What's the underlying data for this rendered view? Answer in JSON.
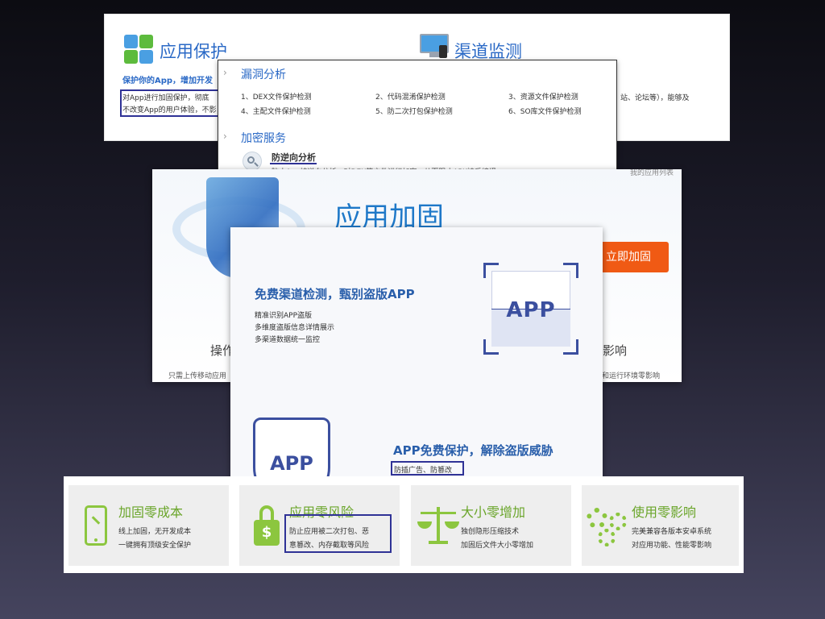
{
  "slide1": {
    "left_title": "应用保护",
    "left_subtitle": "保护你的App，增加开发",
    "left_desc_1": "对App进行加固保护，彻底",
    "left_desc_2": "不改变App的用户体验，不影",
    "right_title": "渠道监测",
    "right_partial": "站、论坛等），能够及"
  },
  "dropdown": {
    "section1_title": "漏洞分析",
    "items": [
      "1、DEX文件保护检测",
      "2、代码混淆保护检测",
      "3、资源文件保护检测",
      "4、主配文件保护检测",
      "5、防二次打包保护检测",
      "6、SO库文件保护检测"
    ],
    "section2_title": "加密服务",
    "service_name": "防逆向分析",
    "service_desc": "防止App被逆向分析，对DEX等文件进行加密，从而阻止APK被反编译"
  },
  "slide2": {
    "title": "应用加固",
    "button": "立即加固",
    "top_right_link": "我的应用列表",
    "left_feature": "操作",
    "left_footer": "只需上传移动应用",
    "right_feature": "影响",
    "right_footer": "能和运行环境零影响"
  },
  "slide3": {
    "block1_title": "免费渠道检测，甄别盗版APP",
    "block1_lines": [
      "精准识别APP盗版",
      "多维度盗版信息详情展示",
      "多渠道数据统一监控"
    ],
    "app_label": "APP",
    "block2_title": "APP免费保护，解除盗版威胁",
    "block2_line": "防插广告、防篡改"
  },
  "features": [
    {
      "title": "加固零成本",
      "line1": "线上加固，无开发成本",
      "line2": "一键拥有顶级安全保护"
    },
    {
      "title": "应用零风险",
      "line1": "防止应用被二次打包、恶",
      "line2": "意篡改、内存截取等风险"
    },
    {
      "title": "大小零增加",
      "line1": "独创隐形压缩技术",
      "line2": "加固后文件大小零增加"
    },
    {
      "title": "使用零影响",
      "line1": "完美兼容各版本安卓系统",
      "line2": "对应用功能、性能零影响"
    }
  ],
  "colors": {
    "feature_green": "#8cc63f",
    "title_blue": "#2a69c6",
    "highlight": "#2f3296",
    "button_orange": "#f05a14"
  }
}
